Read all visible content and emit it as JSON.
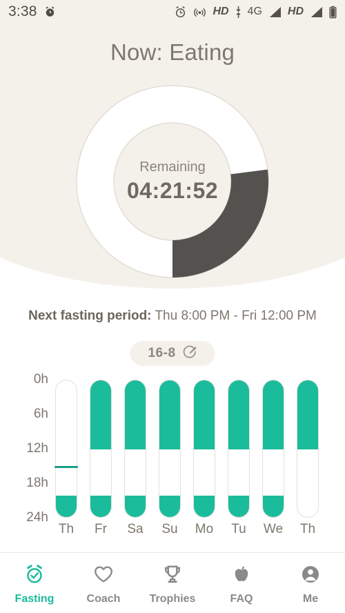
{
  "status_bar": {
    "time": "3:38",
    "left_icons": [
      "alarm-clock-small-icon"
    ],
    "right_icons": [
      "alarm-clock-icon",
      "hotspot-icon",
      "signal-bar-icon-1",
      "signal-bar-icon-2",
      "battery-icon"
    ],
    "hd_label_1": "HD",
    "network_label": "4G",
    "hd_label_2": "HD"
  },
  "header": {
    "title": "Now: Eating"
  },
  "timer": {
    "label": "Remaining",
    "value": "04:21:52",
    "progress_percent": 27,
    "arc_color": "#54524f",
    "track_color": "#ffffff"
  },
  "next_period": {
    "label": "Next fasting period:",
    "value": "Thu 8:00 PM - Fri 12:00 PM"
  },
  "plan_badge": {
    "label": "16-8",
    "edit_icon": "edit-circle-icon"
  },
  "chart_data": {
    "type": "bar",
    "title": "",
    "xlabel": "",
    "ylabel": "",
    "ylim": [
      0,
      24
    ],
    "y_ticks": [
      "0h",
      "6h",
      "12h",
      "18h",
      "24h"
    ],
    "y_tick_values": [
      0,
      6,
      12,
      18,
      24
    ],
    "grid": false,
    "legend": "none",
    "accent_color": "#1bbc9b",
    "marker_hour": 15,
    "marker_color": "#1a9d85",
    "categories": [
      "Th",
      "Fr",
      "Sa",
      "Su",
      "Mo",
      "Tu",
      "We",
      "Th"
    ],
    "bars": [
      {
        "day": "Th",
        "segments": [
          {
            "start": 20,
            "end": 24
          }
        ]
      },
      {
        "day": "Fr",
        "segments": [
          {
            "start": 0,
            "end": 12
          },
          {
            "start": 20,
            "end": 24
          }
        ]
      },
      {
        "day": "Sa",
        "segments": [
          {
            "start": 0,
            "end": 12
          },
          {
            "start": 20,
            "end": 24
          }
        ]
      },
      {
        "day": "Su",
        "segments": [
          {
            "start": 0,
            "end": 12
          },
          {
            "start": 20,
            "end": 24
          }
        ]
      },
      {
        "day": "Mo",
        "segments": [
          {
            "start": 0,
            "end": 12
          },
          {
            "start": 20,
            "end": 24
          }
        ]
      },
      {
        "day": "Tu",
        "segments": [
          {
            "start": 0,
            "end": 12
          },
          {
            "start": 20,
            "end": 24
          }
        ]
      },
      {
        "day": "We",
        "segments": [
          {
            "start": 0,
            "end": 12
          },
          {
            "start": 20,
            "end": 24
          }
        ]
      },
      {
        "day": "Th",
        "segments": [
          {
            "start": 0,
            "end": 12
          }
        ]
      }
    ]
  },
  "bottom_nav": {
    "active_index": 0,
    "active_color": "#1bbc9b",
    "inactive_color": "#8a8a8a",
    "items": [
      {
        "label": "Fasting",
        "icon": "alarm-clock-check-icon"
      },
      {
        "label": "Coach",
        "icon": "heart-icon"
      },
      {
        "label": "Trophies",
        "icon": "trophy-icon"
      },
      {
        "label": "FAQ",
        "icon": "apple-icon"
      },
      {
        "label": "Me",
        "icon": "person-icon"
      }
    ]
  }
}
